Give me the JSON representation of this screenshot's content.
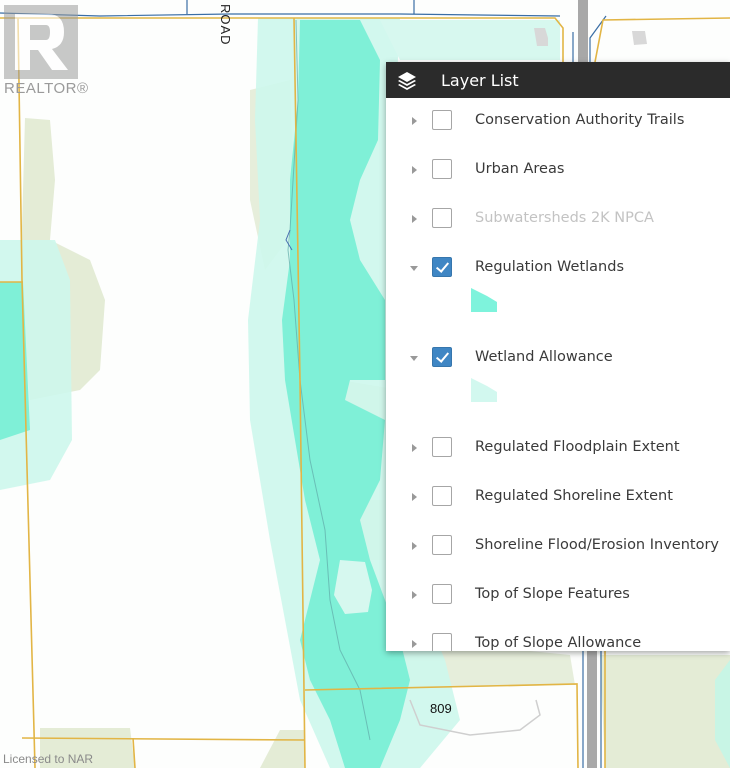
{
  "map": {
    "watermark": {
      "label": "REALTOR®",
      "icon": "realtor-r-logo"
    },
    "road_label": "ROAD",
    "parcel_label": "809",
    "license_text": "Licensed to NAR",
    "colors": {
      "wetland": "#7df0d8",
      "wetland_allowance": "#c8f7ea",
      "woodland": "#e3edd2",
      "parcel_line": "#e3b648",
      "road_line": "#3a6ea5",
      "road_fill": "#a3a3a3",
      "building": "#d9d9d9"
    }
  },
  "layer_panel": {
    "title": "Layer List",
    "icon": "layers-icon",
    "colors": {
      "header_bg": "#2b2b2b",
      "checked": "#3f86c4"
    },
    "layers": [
      {
        "label": "Conservation Authority Trails",
        "checked": false,
        "expanded": false,
        "disabled": false
      },
      {
        "label": "Urban Areas",
        "checked": false,
        "expanded": false,
        "disabled": false
      },
      {
        "label": "Subwatersheds 2K NPCA",
        "checked": false,
        "expanded": false,
        "disabled": true
      },
      {
        "label": "Regulation Wetlands",
        "checked": true,
        "expanded": true,
        "disabled": false,
        "legend_color": "#7ef3dc"
      },
      {
        "label": "Wetland Allowance",
        "checked": true,
        "expanded": true,
        "disabled": false,
        "legend_color": "#d2f8ef"
      },
      {
        "label": "Regulated Floodplain Extent",
        "checked": false,
        "expanded": false,
        "disabled": false
      },
      {
        "label": "Regulated Shoreline Extent",
        "checked": false,
        "expanded": false,
        "disabled": false
      },
      {
        "label": "Shoreline Flood/Erosion Inventory",
        "checked": false,
        "expanded": false,
        "disabled": false
      },
      {
        "label": "Top of Slope Features",
        "checked": false,
        "expanded": false,
        "disabled": false
      },
      {
        "label": "Top of Slope Allowance",
        "checked": false,
        "expanded": false,
        "disabled": false
      }
    ]
  }
}
